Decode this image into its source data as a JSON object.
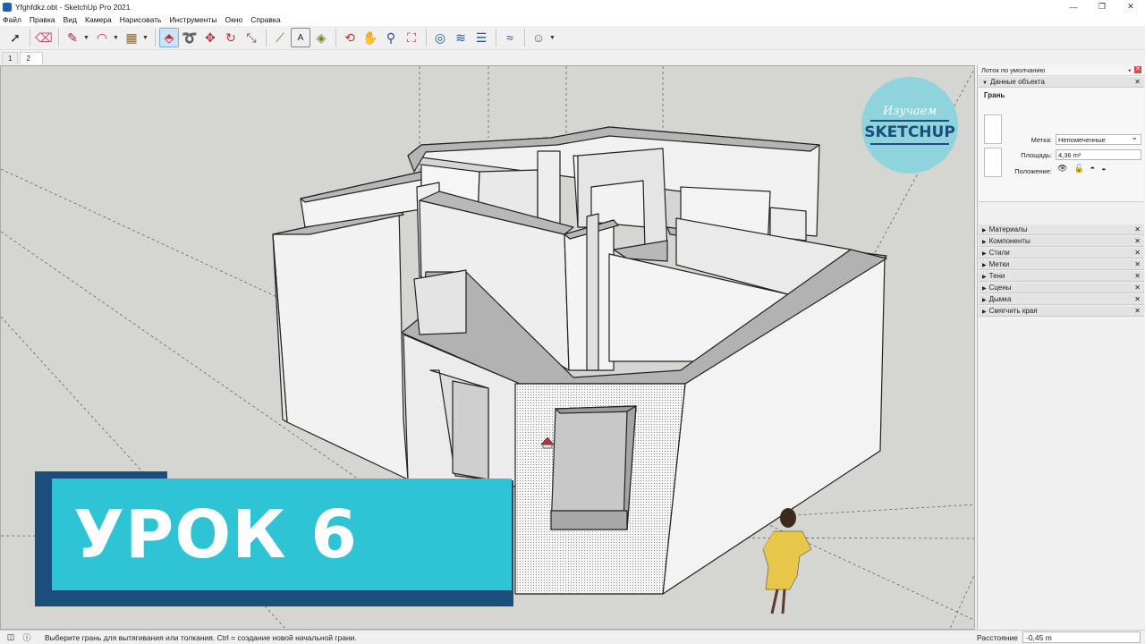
{
  "window": {
    "title": "Yfghfdkz.obt - SketchUp Pro 2021",
    "controls": [
      "—",
      "❐",
      "✕"
    ]
  },
  "menu": [
    "Файл",
    "Правка",
    "Вид",
    "Камера",
    "Нарисовать",
    "Инструменты",
    "Окно",
    "Справка"
  ],
  "toolbar": {
    "tools": [
      {
        "name": "select-icon",
        "glyph": "➚"
      },
      {
        "name": "eraser-icon",
        "glyph": "⌫"
      },
      {
        "name": "pencil-icon",
        "glyph": "✎"
      },
      {
        "name": "arc-icon",
        "glyph": "◠"
      },
      {
        "name": "shape-icon",
        "glyph": "▦"
      },
      {
        "name": "push-pull-icon",
        "glyph": "⬘"
      },
      {
        "name": "follow-me-icon",
        "glyph": "➰"
      },
      {
        "name": "move-icon",
        "glyph": "✥"
      },
      {
        "name": "rotate-icon",
        "glyph": "↻"
      },
      {
        "name": "scale-icon",
        "glyph": "⤡"
      },
      {
        "name": "tape-measure-icon",
        "glyph": "⟋"
      },
      {
        "name": "text-icon",
        "glyph": "A"
      },
      {
        "name": "paint-bucket-icon",
        "glyph": "◈"
      },
      {
        "name": "orbit-icon",
        "glyph": "⟲"
      },
      {
        "name": "pan-icon",
        "glyph": "✋"
      },
      {
        "name": "zoom-icon",
        "glyph": "⚲"
      },
      {
        "name": "zoom-extents-icon",
        "glyph": "⛶"
      },
      {
        "name": "warehouse-icon",
        "glyph": "◎"
      },
      {
        "name": "extension-icon",
        "glyph": "≋"
      },
      {
        "name": "layers-icon",
        "glyph": "☰"
      },
      {
        "name": "sandbox-icon",
        "glyph": "≈"
      },
      {
        "name": "account-icon",
        "glyph": "☺"
      }
    ]
  },
  "scene_tabs": [
    "1",
    "2"
  ],
  "viewport": {
    "background": "#d5d5d2",
    "lesson_banner": "УРОК 6",
    "logo_top": "Изучаем",
    "logo_main": "SKETCHUP"
  },
  "tray": {
    "header": "Лоток по умолчанию",
    "entity_info": {
      "title": "Данные объекта",
      "type": "Грань",
      "tag_label": "Метка:",
      "tag_value": "Непомеченные",
      "area_label": "Площадь:",
      "area_value": "4,36 m²",
      "position_label": "Положение:"
    },
    "panels": [
      "Материалы",
      "Компоненты",
      "Стили",
      "Метки",
      "Тени",
      "Сцены",
      "Дымка",
      "Смягчить края"
    ]
  },
  "status": {
    "message": "Выберите грань для вытягивания или толкания. Ctrl = создание новой начальной грани.",
    "measure_label": "Расстояние",
    "measure_value": "-0,45 m"
  }
}
